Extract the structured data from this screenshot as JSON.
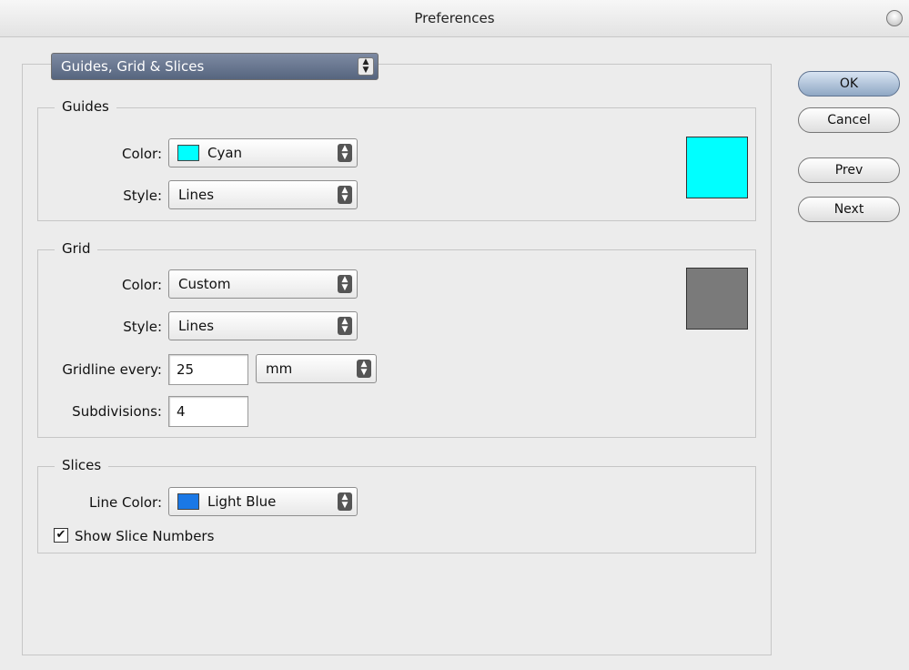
{
  "window": {
    "title": "Preferences"
  },
  "section_selector": {
    "value": "Guides, Grid & Slices"
  },
  "buttons": {
    "ok": "OK",
    "cancel": "Cancel",
    "prev": "Prev",
    "next": "Next"
  },
  "guides": {
    "legend": "Guides",
    "color_label": "Color:",
    "color_value": "Cyan",
    "color_hex": "#00ffff",
    "style_label": "Style:",
    "style_value": "Lines"
  },
  "grid": {
    "legend": "Grid",
    "color_label": "Color:",
    "color_value": "Custom",
    "color_hex": "#7a7a7a",
    "style_label": "Style:",
    "style_value": "Lines",
    "gridline_label": "Gridline every:",
    "gridline_value": "25",
    "gridline_unit": "mm",
    "subdivisions_label": "Subdivisions:",
    "subdivisions_value": "4"
  },
  "slices": {
    "legend": "Slices",
    "line_color_label": "Line Color:",
    "line_color_value": "Light Blue",
    "line_color_hex": "#1a78e6",
    "show_numbers_label": "Show Slice Numbers",
    "show_numbers_checked": true
  },
  "icons": {
    "popup_arrows": "up-down-arrows-icon",
    "window_zoom": "window-zoom-icon",
    "checkbox": "checkmark-icon"
  }
}
